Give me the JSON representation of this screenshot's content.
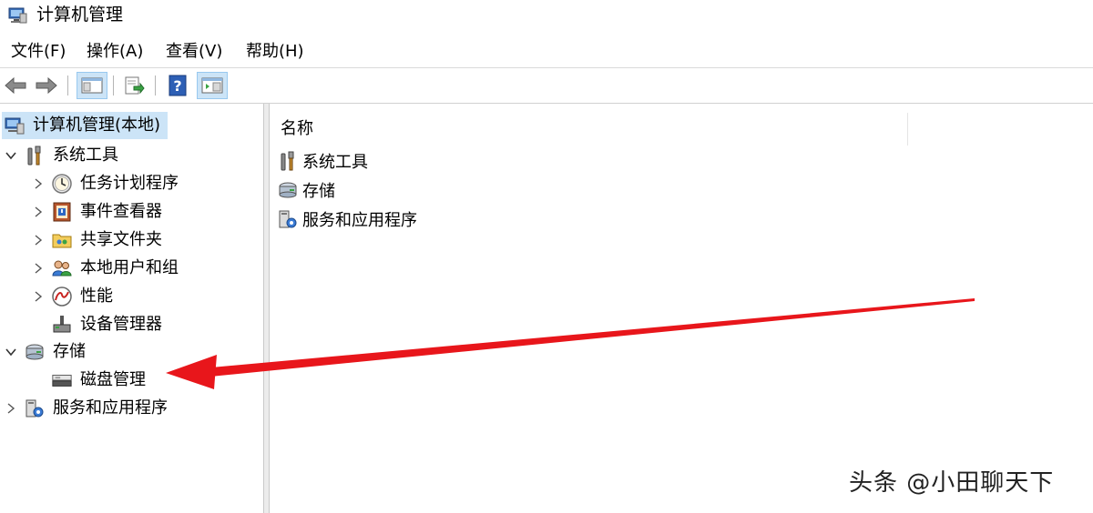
{
  "window": {
    "title": "计算机管理"
  },
  "menu": [
    {
      "label": "文件(F)"
    },
    {
      "label": "操作(A)"
    },
    {
      "label": "查看(V)"
    },
    {
      "label": "帮助(H)"
    }
  ],
  "toolbar": {
    "buttons": [
      "back-arrow-icon",
      "forward-arrow-icon",
      "show-hide-tree-icon",
      "export-list-icon",
      "help-icon",
      "show-hide-action-pane-icon"
    ]
  },
  "tree": {
    "root": "计算机管理(本地)",
    "system_tools": "系统工具",
    "task_scheduler": "任务计划程序",
    "event_viewer": "事件查看器",
    "shared_folders": "共享文件夹",
    "local_users": "本地用户和组",
    "performance": "性能",
    "device_manager": "设备管理器",
    "storage": "存储",
    "disk_management": "磁盘管理",
    "services_apps": "服务和应用程序"
  },
  "list": {
    "column_name": "名称",
    "items": [
      "系统工具",
      "存储",
      "服务和应用程序"
    ]
  },
  "annotation": {
    "arrow_color": "#e8161b"
  },
  "watermark": "头条 @小田聊天下"
}
